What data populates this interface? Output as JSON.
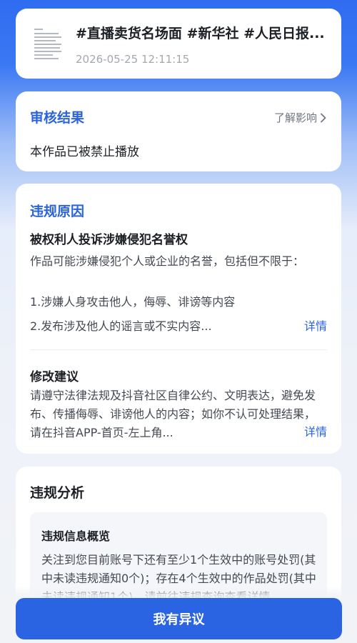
{
  "header": {
    "title": "#直播卖货名场面 #新华社 #人民日报...",
    "timestamp": "2026-05-25 12:11:15",
    "thumbnail_icon": "document-thumbnail"
  },
  "review": {
    "title": "审核结果",
    "learn_more": "了解影响",
    "learn_more_icon": "chevron-right-icon",
    "status": "本作品已被禁止播放"
  },
  "reason": {
    "title": "违规原因",
    "heading": "被权利人投诉涉嫌侵犯名誉权",
    "description": "作品可能涉嫌侵犯个人或企业的名誉，包括但不限于：",
    "items": [
      "1.涉嫌人身攻击他人，侮辱、诽谤等内容",
      "2.发布涉及他人的谣言或不实内容..."
    ],
    "detail_link": "详情",
    "fix_heading": "修改建议",
    "fix_text": "请遵守法律法规及抖音社区自律公约、文明表达，避免发布、传播侮辱、诽谤他人的内容；如你不认可处理结果，请在抖音APP-首页-左上角...",
    "fix_detail_link": "详情"
  },
  "analysis": {
    "title": "违规分析",
    "overview_title": "违规信息概览",
    "overview_text": "关注到您目前账号下还有至少1个生效中的账号处罚(其中未读违规通知0个)；存在4个生效中的作品处罚(其中未读违规通知1个)，请前往违规查询查看详情"
  },
  "actions": {
    "dispute_label": "我有异议"
  },
  "colors": {
    "accent": "#2b64e3",
    "section_title": "#2b64d9",
    "background_top": "#2f6cf1",
    "background_bottom": "#f1f3f7"
  }
}
